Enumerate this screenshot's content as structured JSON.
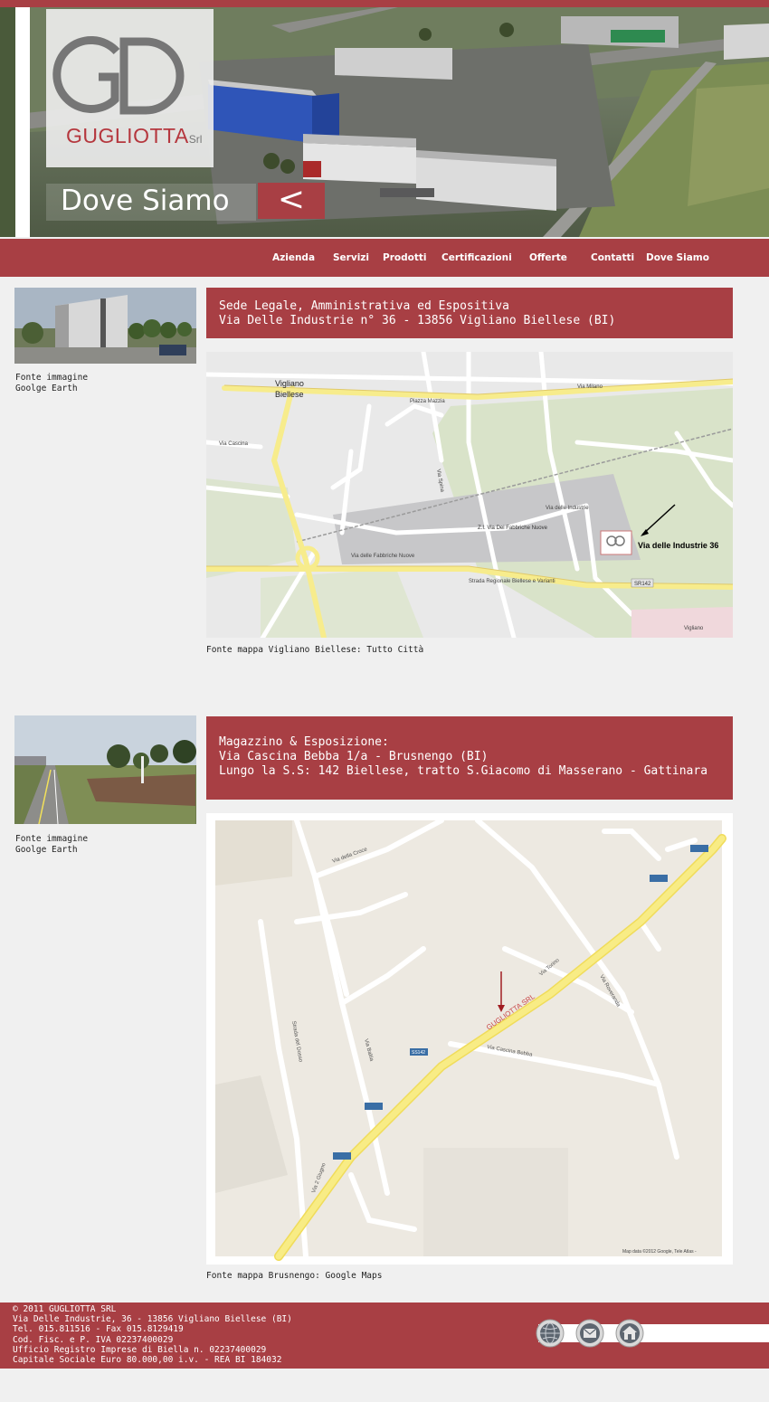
{
  "header": {
    "logo_word": "GUGLIOTTA",
    "logo_suffix": "Srl",
    "page_title": "Dove Siamo",
    "back_label": "<"
  },
  "nav": {
    "items": [
      "Azienda",
      "Servizi",
      "Prodotti",
      "Certificazioni",
      "Offerte",
      "Contatti",
      "Dove Siamo"
    ]
  },
  "locations": [
    {
      "photo_caption": [
        "Fonte immagine",
        "Goolge Earth"
      ],
      "address_lines": [
        "Sede Legale, Amministrativa ed Espositiva",
        "Via Delle Industrie n° 36 - 13856 Vigliano Biellese (BI)"
      ],
      "map_source": "Fonte mappa Vigliano Biellese: Tutto Città",
      "map_labels": {
        "town": "Vigliano",
        "town2": "Biellese",
        "pin_label": "Via delle Industrie 36",
        "road1": "Via Milano",
        "road2": "Strada Regionale Biellese e Varianti",
        "road3": "Via delle Fabbriche Nuove",
        "road4": "Via delle Industrie",
        "road5": "Via Spina",
        "road6": "Via Cascina",
        "road7": "Piazza Mazzia",
        "area": "Z.I. Via Dei Fabbriche Nuove",
        "badge": "SR142",
        "corner": "Vigliano"
      }
    },
    {
      "photo_caption": [
        "Fonte immagine",
        "Goolge Earth"
      ],
      "address_lines": [
        "Magazzino & Esposizione:",
        "Via Cascina Bebba 1/a - Brusnengo (BI)",
        "Lungo la S.S: 142 Biellese, tratto S.Giacomo di Masserano - Gattinara"
      ],
      "map_source": "Fonte mappa Brusnengo: Google Maps",
      "map_labels": {
        "pin_label": "GUGLIOTTA SRL",
        "road1": "Via Torino",
        "road2": "Via Cascina Bebba",
        "road3": "Via Roveranda",
        "road4": "Strada del Dosso",
        "road5": "Via Baltia",
        "road6": "Via 2 Giugno",
        "road7": "Via della Croce",
        "badge": "SS142",
        "attribution": "Map data ©2012 Google, Tele Atlas -"
      }
    }
  ],
  "footer": {
    "lines": [
      "© 2011 GUGLIOTTA SRL",
      "Via Delle Industrie, 36 - 13856 Vigliano Biellese (BI)",
      "Tel. 015.811516 - Fax 015.8129419",
      "Cod. Fisc. e P. IVA 02237400029",
      "Ufficio Registro Imprese di Biella n. 02237400029",
      "Capitale Sociale Euro 80.000,00 i.v. - REA BI 184032"
    ],
    "icons": [
      "globe-icon",
      "mail-icon",
      "home-icon"
    ]
  },
  "colors": {
    "brand_red": "#a83f44",
    "background": "#f0f0f0"
  }
}
